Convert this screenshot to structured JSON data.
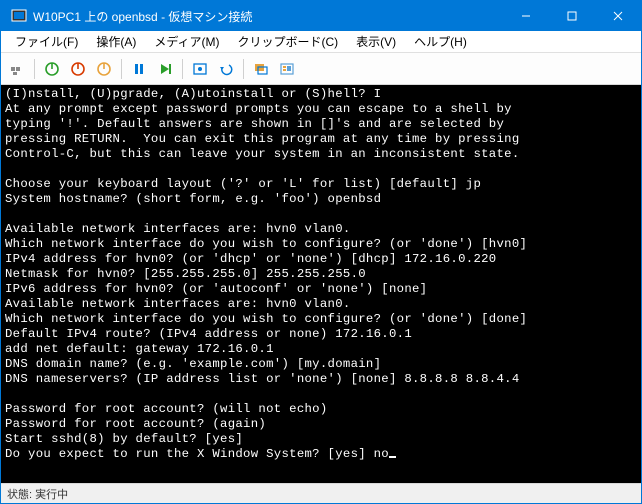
{
  "window": {
    "title": "W10PC1 上の openbsd - 仮想マシン接続"
  },
  "menu": {
    "file": "ファイル(F)",
    "action": "操作(A)",
    "media": "メディア(M)",
    "clipboard": "クリップボード(C)",
    "view": "表示(V)",
    "help": "ヘルプ(H)"
  },
  "status": {
    "label": "状態:",
    "value": "実行中"
  },
  "terminal_lines": [
    "(I)nstall, (U)pgrade, (A)utoinstall or (S)hell? I",
    "At any prompt except password prompts you can escape to a shell by",
    "typing '!'. Default answers are shown in []'s and are selected by",
    "pressing RETURN.  You can exit this program at any time by pressing",
    "Control-C, but this can leave your system in an inconsistent state.",
    "",
    "Choose your keyboard layout ('?' or 'L' for list) [default] jp",
    "System hostname? (short form, e.g. 'foo') openbsd",
    "",
    "Available network interfaces are: hvn0 vlan0.",
    "Which network interface do you wish to configure? (or 'done') [hvn0]",
    "IPv4 address for hvn0? (or 'dhcp' or 'none') [dhcp] 172.16.0.220",
    "Netmask for hvn0? [255.255.255.0] 255.255.255.0",
    "IPv6 address for hvn0? (or 'autoconf' or 'none') [none]",
    "Available network interfaces are: hvn0 vlan0.",
    "Which network interface do you wish to configure? (or 'done') [done]",
    "Default IPv4 route? (IPv4 address or none) 172.16.0.1",
    "add net default: gateway 172.16.0.1",
    "DNS domain name? (e.g. 'example.com') [my.domain]",
    "DNS nameservers? (IP address list or 'none') [none] 8.8.8.8 8.8.4.4",
    "",
    "Password for root account? (will not echo)",
    "Password for root account? (again)",
    "Start sshd(8) by default? [yes]",
    "Do you expect to run the X Window System? [yes] no"
  ]
}
